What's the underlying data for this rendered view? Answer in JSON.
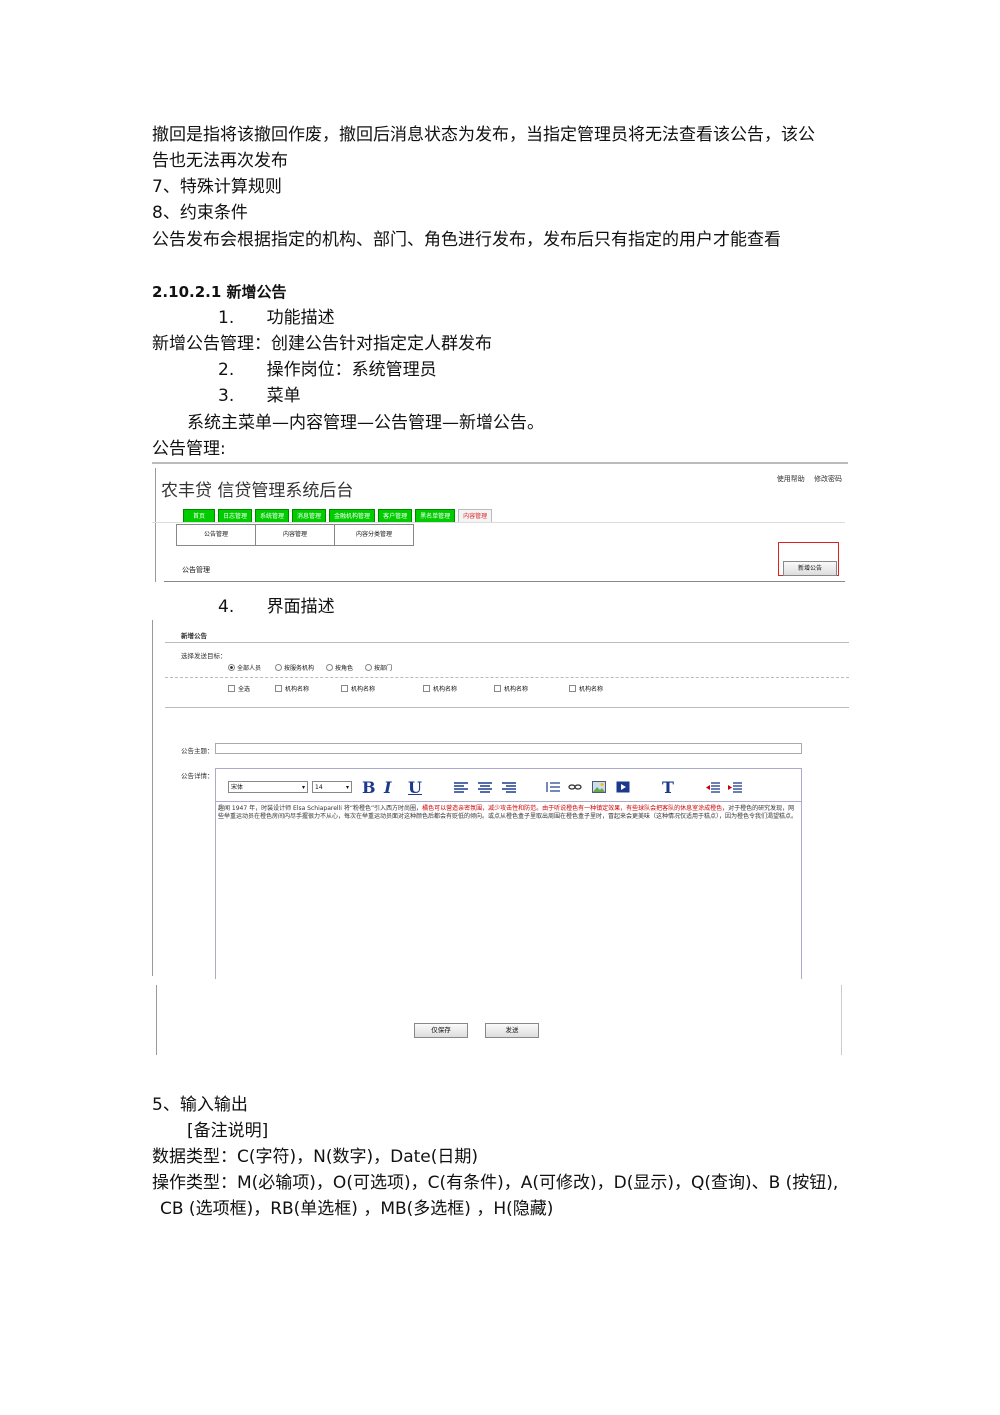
{
  "doc": {
    "para_recall_line1": "撤回是指将该撤回作废，撤回后消息状态为发布，当指定管理员将无法查看该公告，该公",
    "para_recall_line2": "告也无法再次发布",
    "h7": "7、特殊计算规则",
    "h8": "8、约束条件",
    "constraint": "公告发布会根据指定的机构、部门、角色进行发布，发布后只有指定的用户才能查看",
    "section_title": "2.10.2.1 新增公告",
    "item1": "1.      功能描述",
    "func_desc": "新增公告管理：创建公告针对指定定人群发布",
    "item2": "2.      操作岗位：系统管理员",
    "item3": "3.      菜单",
    "menu_path": "系统主菜单—内容管理—公告管理—新增公告。",
    "shot_caption": "公告管理:",
    "item4": "4.      界面描述",
    "h5": "5、输入输出",
    "remark": "[备注说明]",
    "data_types": "数据类型：C(字符)，N(数字)，Date(日期)",
    "op_types_line1": "操作类型：M(必输项)，O(可选项)，C(有条件)，A(可修改)，D(显示)，Q(查询)、B (按钮),",
    "op_types_line2": "CB (选项框)，RB(单选框) ，MB(多选框) ，H(隐藏)"
  },
  "shot1": {
    "brand": "农丰贷",
    "system_name": "信贷管理系统后台",
    "top_links": [
      "使用帮助",
      "修改密码"
    ],
    "menus": [
      "首页",
      "日志管理",
      "系统管理",
      "消息管理",
      "金融机构管理",
      "客户管理",
      "黑名单管理",
      "内容管理"
    ],
    "active_menu": "内容管理",
    "submenus": [
      "公告管理",
      "内容管理",
      "内容分类管理"
    ],
    "page_name": "公告管理",
    "add_button": "新增公告"
  },
  "shot2": {
    "form_title": "新增公告",
    "target_label": "选择发送目标：",
    "radios": [
      "全部人员",
      "按服务机构",
      "按角色",
      "按部门"
    ],
    "checks": [
      "全选",
      "机构名称",
      "机构名称",
      "机构名称",
      "机构名称",
      "机构名称"
    ],
    "subject_label": "公告主题：",
    "detail_label": "公告详情：",
    "font_name": "宋体",
    "font_size": "14",
    "content_part1": "趣闻 1947 年，时装设计师 Elsa Schiaparelli 将“粉橙色”引入西方时尚圈，",
    "content_highlight": "橘色可以营造亲密氛围，减少攻击性和防范。由于听说橙色有一种镇定效果，有些球队会把客队的休息室涂成橙色，",
    "content_part2": "对于橙色的研究发现，网些举重运动员在橙色房间内尽手握很力不从心，每次在举重运动员面对这种颜色后都会有贬低的倾向。或点从橙色盒子里取出周围在橙色盒子里时，冒起来会更美味（这种情况仅适用于糕点），因为橙色令我们渴望糕点。",
    "save_button": "仅保存",
    "send_button": "发送"
  }
}
